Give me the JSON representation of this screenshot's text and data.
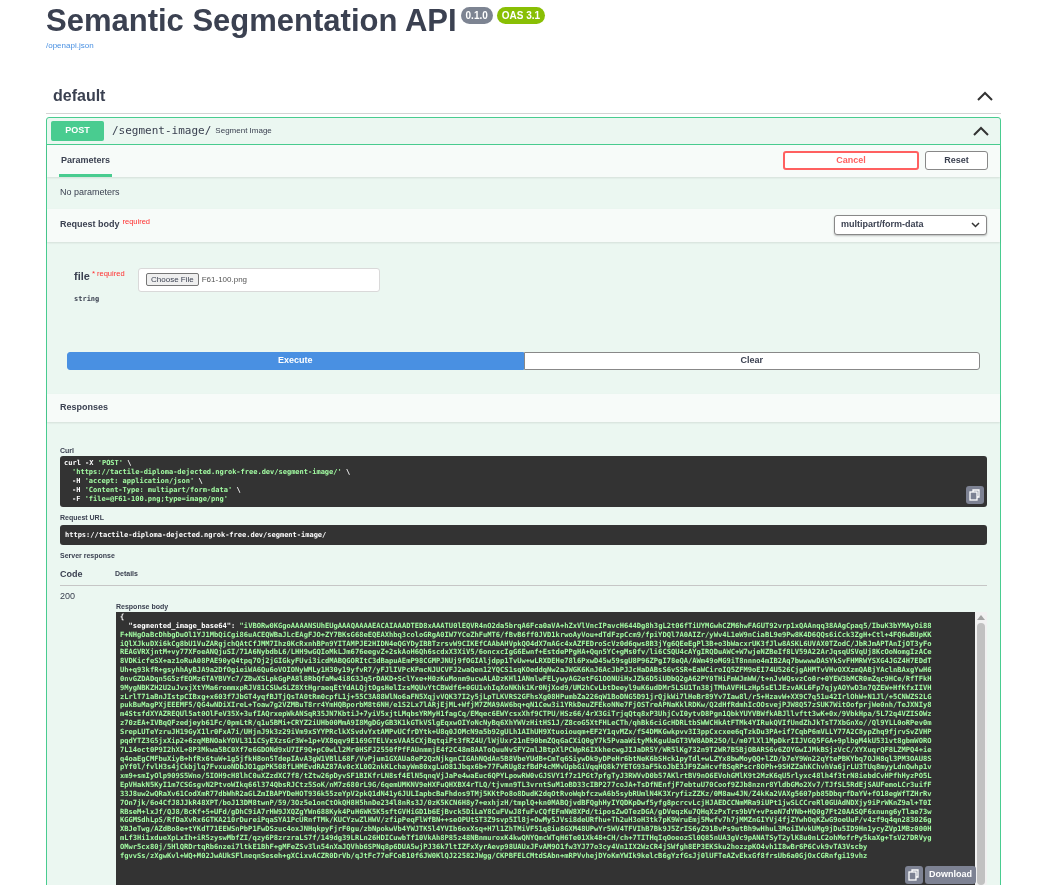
{
  "title": "Semantic Segmentation API",
  "version_badge": "0.1.0",
  "oas_badge": "OAS 3.1",
  "spec_link": "/openapi.json",
  "section": {
    "title": "default",
    "expanded": true
  },
  "operation": {
    "method": "POST",
    "path": "/segment-image/",
    "summary": "Segment Image",
    "expanded": true,
    "tabs": [
      {
        "label": "Parameters",
        "selected": true
      }
    ],
    "cancel_button": "Cancel",
    "reset_button": "Reset",
    "no_parameters": "No parameters",
    "request_body": {
      "title": "Request body",
      "required": "required",
      "content_type": "multipart/form-data"
    },
    "field": {
      "name": "file",
      "asterisk": "*",
      "required": "required",
      "type": "string",
      "button": "Choose File",
      "value": "F61-100.png"
    },
    "execute_button": "Execute",
    "clear_button": "Clear",
    "responses": {
      "title": "Responses",
      "curl_label": "Curl",
      "curl_lines": [
        {
          "cmd": "curl -X",
          "arg": "'POST'",
          "cont": "\\"
        },
        {
          "arg": "'https://tactile-diploma-dejected.ngrok-free.dev/segment-image/'",
          "cont": "\\"
        },
        {
          "cmd": "-H",
          "arg": "'accept: application/json'",
          "cont": "\\"
        },
        {
          "cmd": "-H",
          "arg": "'Content-Type: multipart/form-data'",
          "cont": "\\"
        },
        {
          "cmd": "-F",
          "arg": "'file=@F61-100.png;type=image/png'"
        }
      ],
      "request_url_label": "Request URL",
      "request_url": "https://tactile-diploma-dejected.ngrok-free.dev/segment-image/",
      "server_response_label": "Server response",
      "columns": [
        "Code",
        "Details"
      ],
      "code": "200",
      "body_label": "Response body",
      "body": {
        "open": "{",
        "key": "\"segmented_image_base64\": ",
        "lines": [
          "\"iVBORw0KGgoAAAANSUhEUgAAAQAAAAEACAIAAADTED8xAAATU0lEQVR4nO2da5brqA6Fca0aVA+hZxVlVncIPavcH644Dg8h3gL2t06fTiUYMGwhCZM6hwFAGUT92vrp1xQAAnqq38AAgCpaq5/IbuK3bYMAyOi88",
          "F+NHgOaBcDhbgDuOl1YJ1MbQiCgi86uACEQWBaJLcEAgFJO+ZY7BKsG68eEQEAXhbq3coloGRgA0IW7YCeZhFuMT6/fBvB6ff0JVD1krwoAyVou+dTdFzpCcm9/fpiYDQl7A0AIZr/yWv4L1eW9nCiaBL9e9Pw8K4D6QQs6iCck3ZgH+Ctl+4FQ6wBUpKK",
          "iQlXJkuDXi6kCg8bU1VuZARgjchQAtCfJMM7Ihz0KcRxnhBPn9YITAMPJE2HIDN4eQGYDyIBBTzrsvW9CIKEfCAAbAHVpkQO4dX7mAGc4xAZFEDroScVz0d6qws8B3jYg6QEeEgPl3B+o3bWacxrUK3fJlw8ASKL6UVAX0TZodC/JbRJmAPTAnIjOT3yFo",
          "REAGVRXjntM+vy77XFoeANQjuSI/71A6NybdbL6/LHH9wGQIoMkLJm676eegvZ+2skAoH6Qh6scdxX3XiV5/6oncxcIgG6Ewnf+EstdePPgHA+Qqn5YC+gMs0fv/li6CSQU4cAYgIRQDuAWC+W7wjeNZBeIf8LV59A22ArJqsqUSVqUj8KcOoNomgIzACe",
          "8VDKicfeSX+az1oRuA08PAE90yQ4tpq7Oj2jGIGkyFUvi3icdMABQGORItC3dBapuAEmP98CGMPJNUj9fOGIAljdpp1TvUw+wLRXDEHe78l6PxwD45w59sgU8P96ZPgI78eQA/AWm49oMG9iT8nnno4mIB2Aq7bwwwwDASYkSvFHMRWYSXG4JGZ4H7EDdT",
          "Uh+q93kfR+gsyhhAyBJA9a2DfOgieiWA6Qu6oVOIONyWMLy1H30y19yfvR7/yFJlIVPcKFmcNJUCVFJ2waQen12YQCS1sqKOeddqNw2aJWGK6KnJ6AcJbPJJcHaDABsS6vSSR+EaWCiroIQ5ZFM9oEI74U526CjgAHMTvVHvOXXzmQABjYAclnBAxgYwH6",
          "0nvGZDADqn5G5zfEOMz6TAYBVYc7/ZBwXSLpkGgPA8l8RbQfaMw4i8G3Jq5rDAKD+SclYxe+H0zKuMonm9ucwALADzKHl1ANmlwFELywyAG2etFG1OONUiHxJZk6D5iUDbQ2gA62PY0THiFmWJmWW/t+nJvWQsvzCo0r+0YEW3bMCR0mZqc9HCe/RfTFkH",
          "9MygNBKZH2U2uJvxjXtYMa6rommxpRJV81CSUwSLZ8XtHgraeqEtYdALQjtOgsHelIzsMQUvYtCBWdf6+0GU1vhIqXoNKhk1Kr0NjXod9/UM2hCvLbtDeeyl9uK6udDMr5LSU1Tn38jTMhAVFHLzHp5sElJEzvAKL6Fp7qjyAOYwD3n7QZEW+HfKfxIIVH",
          "zLrlT71aBnJIstpCIBxg+x603f7JbGT4yqfBJTjQsTA0tRm0cpfL1j+55C3A88WlNo6aFN5XqjvVQK37I2y5jLpTLKVRS2GFhsXg08HPumbZa226qW1BoDNG5D91jrQjkWi7lHeBr89Yv7Iaw8l/r5+HzavW+XX9C7q51u42IrlOhW+N1Jl/+5CNWZS2LG",
          "pukBuMagPXjEEEMF5/QG4wNDiXIreL+Toaw7g2VZMBuT8rr4YmHQBporbM8t6NH/e1S2Lx7lARjEjML+WfjM7ZMA9AW6bq+qN1Cew3i1YRkDeuZFEkoNNe7FjOSTreAPNaKklRDKw/Q2dHfRdmhIcOOsvejPJW8Q57zSUK7WitOofprjWe0nh/TeJXNIy8",
          "m4StsfdXYAZREQUl5at0OlFeV35X+3ufIAQrxepWkANSqR35JN7KbtiJ+7yiV5xjtLMqbsYRMyH1fagCq/EMqec6EWYcsxXhf9CTPU/HSz66/4rX3GiTrjqQtq8xP3UhjCvI0ytvD8Pgn1QbkYUYVBWfkABJllvftt3wK+0x/9VbkHpa/5L72q4VZISOWz",
          "z70zEA+IVBqQFzedjeyb61Fc/0pmLtR/q1u5BMi+CRYZ2iUHb00MmA9I8MgDGyGB3K1kGTkVSlgEqxwOIYoNcNyBq6XhYWVzHitHS1J/Z8coG5XtFHLeCTh/qhBk6ciGcHDRLtbSWWCHkAtFTMk4YIRukQVIfUndZhJkTsT7XbGnXo//Ql9YLL0oRPev0m",
          "SrepLUTeYzruJH19GyX1lr0FxA7i/UHjnJ9k3z29iVm9xSYYPRclkXSvdvYxtAMPvUCfrDYtk+U8q0JOMcN9a5b92gULh1AIhUH9Xtuoiouqm+EF2Y1qvMZx/fS4DMKGwkpvv3I3ppCxcxee6qTzkDu3PA+if7CqbP6mVLLY77A2C8ypZhq9fjrvSvZVHP",
          "pqdYTZ3G5jxXip2+6zqMBNOakYOVL311CSyEXzsGr3W+1p+VX8qqv9E169GTELVxsVAA5CXjBqtqiFt3fRZ4U/lWjUxr21nE90bmZQqGaCXiQ0gY7k5PvaaWityMkKguUaGT3VW8ADR25O/L/m07lXl1MpDkrIIJVGQ5FGA+9plbgM4kU531vt8gbmWORO",
          "7L14oct0P9I2hXL+8P3Mkwa5BC0Xf7e6GDONd9xU7IF9Q+pC0wLl2Mr0HSFJ2550fPfFAUnmmjE4f2C48m8AAToQuuNvSFY2mlJBtpXlPCWpR6IXkhecwgJIJaDR5Y/WR5lKg732n9T2WR7B5BjOBARS6v6ZOYGwIJMkBSjzVcC/XYXuqrQF8LZMPQ4+ie",
          "q4oaEgCMFbuXiyB+hfRx6tuW+1g5jfkH8on5TdepIAvA3gW1VBlL68F/VvPjum1GXAUa8eP2QzNjkgnCIGAhNQdAn5B8VbeYUdB+CmTq6SiywDk9yDPeHr6btNeK6bSHck1pyTdl+wLZYx8bwMoyQQ+lZD/b7eY9Wn22qYtePBKYbq7OJH8ql3PM3OAU8S",
          "pYf0l/fvlH3s4jCkbjlq7FvxuoNDbJO1gpPK508fLHMEvdRAZ87Av0cXL0O2nkKLchayWm80xgLuO81Jbqx6b+77FwRUg8zfBdP4cMMvUpbGiVqqHQ8k7YETG93aF5koJbE3JF9ZaHcvfBSqRPscr8OPh+9SHZZahKChvhVa6jrLU3TUq8myyLdnQwhp1v",
          "xm9+smIyOlp909S5Wno/5IOH9cH8lhC0uXZzdXC7f8/tZtw26pDyvSF1BIKfrLN8sf4ElN5qnqVjJaPe4waEuc6QPYLpowRW0vGJSVY1f7z1PGt7pfgTyJ3RWVvD0b57AKlrtBV9nO6EVohGMlK9t2MzK6qU5rlyxc48lh4f3trN8iebdCvHPfhHyzPO5L",
          "EpVHakN5KyI1m7CSGsgvN2PtvoWIkq66l374QbsRJCtz5SoK/nM7z680rL9G/6qemUMKNV9eHXFuQHXBX4rTLQ/tjvmn9TL3vrntSuM1oBD33cIBP277coJA+TsDfNEnfjF7ebtuU70Coof9ZJb8nznr8YldbGMo2Xv7/TJfSL5RdEjSAUFemoLCr3uifF",
          "33J8uw2wQRaXv61CodXmR77dbWhR2aGLZmIBAPYDeHOT936k55zeYpV2pkQ1dN41y6JULIapbcBaFhdos9TMj5KKtPo8o8DudK2dqOtRvoWqbfczwA6b5sybRUmlN4K3XryfizZZKz/0M8aw4JN/Z4kKa2VAXg5607pb85DbqrfDaYV+fO18egWfTZHrRv",
          "7On7jk/6o4CfJ8JJkR48XPT/boJ13DM8twnP/59/3Oz5e1onCtOkQH8H5hnDe234l8nRs3J/0zK5KCN6H8y7+exhjzH/tmplQ+kn0MABQjvdBFQghHyIYQDKpDwf5yfg8pcrcvLcjHJAEDCCNmMRa9iUPt1jwSLCCreRl0GUAdNDXjy9iPrWKnZ9al+T0I",
          "RBseM+lxJf/QJ8/BcKf+5+UFd/gDhC9iA7rHW9JXQZgYWn688Kyk4PuH6WK5K5sftGVHiGD1b6EjBvck5DiLaY8CuFVwJ8fuFvCQfEFmNW8XPd/tiposZwOTezDGA/gDVeqzKu7QHqXzPxTrs9bVY+vPseN7dYNb+HQ0g7Ft20AASQF6xnung6yTlae73w",
          "KGGMSdhLpS/RfDaXvRx6GTKA210rDureiPqaSYA1PcURnfTMk/KUCYzwZlHWV/zfipPeqFlWfBN++seOPUtST3Z9svp5Il8j+OwMy5JVsi8deURfhu+Th2uH3oH3tk7pK9WruEmj5Mwfv7h7jMMZnGIYVj4fjZYwhOqKZwG9oeUuF/v4zf9q4qn283026g",
          "XBJeTwg/AZdBo8e+tYKdT71EEWSnPbP1FwDSzuc4oxJNHqkpyFjrF0gu/zbNpokwVb4YWJTK5l4YVIb6oxXsq+H7l1ZhTMiVF51q8iu8GXM48UPwYr5WV4TFVIhB7Bk9J5ZrIS6yZ91BvPs9utBh9wHhuL3MoiIWvkUMg9jDu5ID9Hn1ycyZVp1MBz000H",
          "mLf3Hi1xdueXpLxIh+iR5zyswMbfZI/qzy6P8zrzraLS7f/149dg39LRLn26HDICuwbTf10VkAh8P85z48NBnmuroxK4kwQNYQmcWTqH6Te01Xk48+CH/ch+7TITHqIqOoeozSl0Q85nUA3gVc9pANATSyT2ylK8u0nLC2ohMofrPy5kaXg+TsV27DRVyg",
          "OMwr5cx80j/5HlQRDrtqRb6nzei7ltkE1BhF+gMFeZSv3ln54nXaJQVhb6SPNq8p6DUA5wjPJ36k7ltIZFxXyrAevp98UAUxJFvAM9O1fw3YJ77o3cy4Vn1IX2WzCR4jSWfgh8EP3EKSku2hozzpKO4vh1I8wBr6P6Cvk9vTA3Vscby",
          "fgvvSs/zXgwKvl+WQ+M02JwAUkSFlneqnSeseh+gXCixvACZR0DrVb/qJtFc77eFCoB10f6JW0KlQJ22582JWgg/CKPBFELCMtdSAbn+mRPVvhejDYoKmYWIk9kelcB6gYzfGsJj0lUFTeAZvEkxGf8frsUb6a0GjOxCGRnfgi19vhz"
        ]
      },
      "download_button": "Download"
    }
  }
}
